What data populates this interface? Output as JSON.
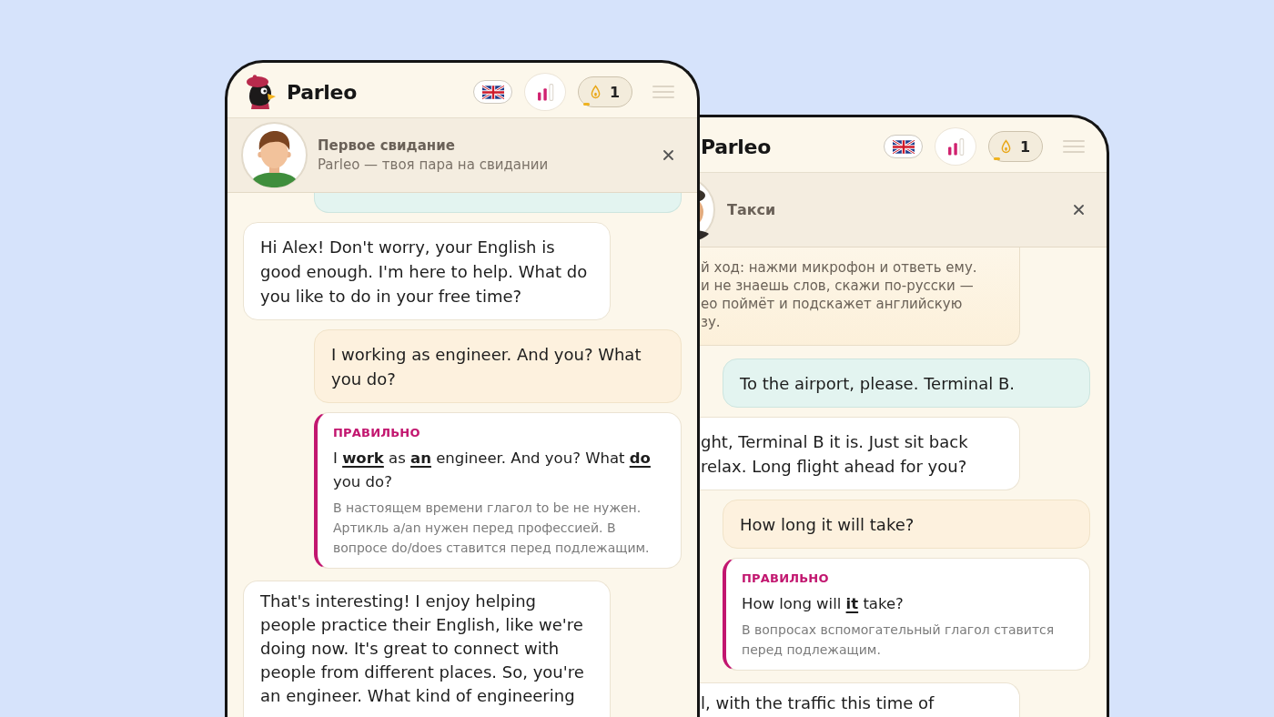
{
  "screens": [
    {
      "header": {
        "brand": "Parleo",
        "streak": {
          "count": "1",
          "level": 0.15
        }
      },
      "scenario": {
        "title": "Первое свидание",
        "subtitle": "Parleo — твоя пара на свидании"
      },
      "messages": [
        {
          "kind": "user",
          "has_mistake": false
        },
        {
          "kind": "bot",
          "text": "Hi Alex! Don't worry, your English is good enough. I'm here to help. What do you like to do in your free time?"
        },
        {
          "kind": "user",
          "has_mistake": true,
          "text": "I working as engineer. And you? What you do?"
        },
        {
          "kind": "correction",
          "label": "ПРАВИЛЬНО",
          "text": "I **work** as **an** engineer. And you? What **do** you do?",
          "explanation": "В настоящем времени глагол to be не нужен. Артикль a/an нужен перед профессией. В вопросе do/does ставится перед подлежащим."
        },
        {
          "kind": "bot",
          "text": "That's interesting! I enjoy helping people practice their English, like we're doing now. It's great to connect with people from different places. So, you're an engineer. What kind of engineering"
        }
      ]
    },
    {
      "header": {
        "brand": "Parleo",
        "streak": {
          "count": "1",
          "level": 0.15
        }
      },
      "scenario": {
        "title": "Такси"
      },
      "messages": [
        {
          "kind": "hint",
          "lines": [
            "й ход: нажми микрофон и ответь ему.",
            "и не знаешь слов, скажи по-русски —",
            "ео поймёт и подскажет английскую",
            "зу."
          ]
        },
        {
          "kind": "user",
          "has_mistake": false,
          "text": "To the airport, please. Terminal B."
        },
        {
          "kind": "bot",
          "lines": [
            "ght, Terminal B it is. Just sit back",
            "relax. Long flight ahead for you?"
          ]
        },
        {
          "kind": "user",
          "has_mistake": true,
          "text": "How long it will take?"
        },
        {
          "kind": "correction",
          "label": "ПРАВИЛЬНО",
          "text": "How long will **it** take?",
          "explanation": "В вопросах вспомогательный глагол ставится перед подлежащим."
        },
        {
          "kind": "bot",
          "lines": [
            "l, with the traffic this time of"
          ]
        }
      ]
    }
  ]
}
